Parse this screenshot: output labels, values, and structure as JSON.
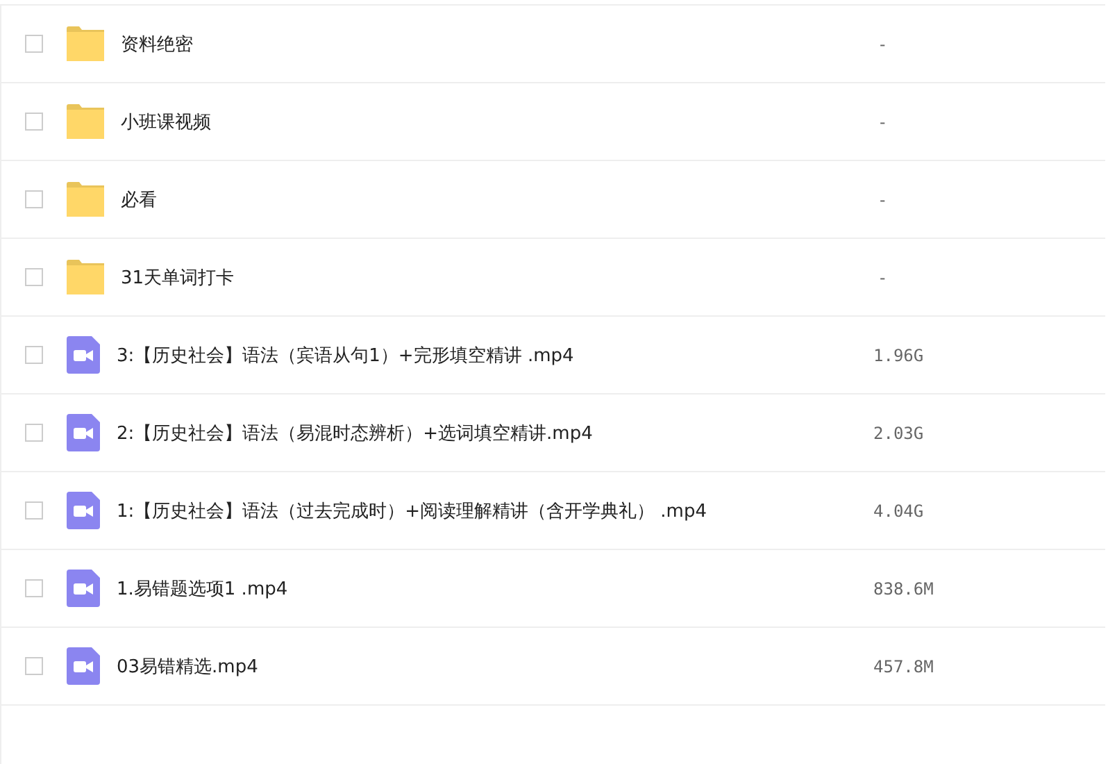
{
  "files": [
    {
      "kind": "folder",
      "name": "资料绝密",
      "size": "-",
      "checked": false
    },
    {
      "kind": "folder",
      "name": "小班课视频",
      "size": "-",
      "checked": false
    },
    {
      "kind": "folder",
      "name": "必看",
      "size": "-",
      "checked": false
    },
    {
      "kind": "folder",
      "name": "31天单词打卡",
      "size": "-",
      "checked": false
    },
    {
      "kind": "video",
      "name": "3:【历史社会】语法（宾语从句1）+完形填空精讲 .mp4",
      "size": "1.96G",
      "checked": false
    },
    {
      "kind": "video",
      "name": "2:【历史社会】语法（易混时态辨析）+选词填空精讲.mp4",
      "size": "2.03G",
      "checked": false
    },
    {
      "kind": "video",
      "name": "1:【历史社会】语法（过去完成时）+阅读理解精讲（含开学典礼） .mp4",
      "size": "4.04G",
      "checked": false
    },
    {
      "kind": "video",
      "name": "1.易错题选项1 .mp4",
      "size": "838.6M",
      "checked": false
    },
    {
      "kind": "video",
      "name": "03易错精选.mp4",
      "size": "457.8M",
      "checked": false
    }
  ]
}
